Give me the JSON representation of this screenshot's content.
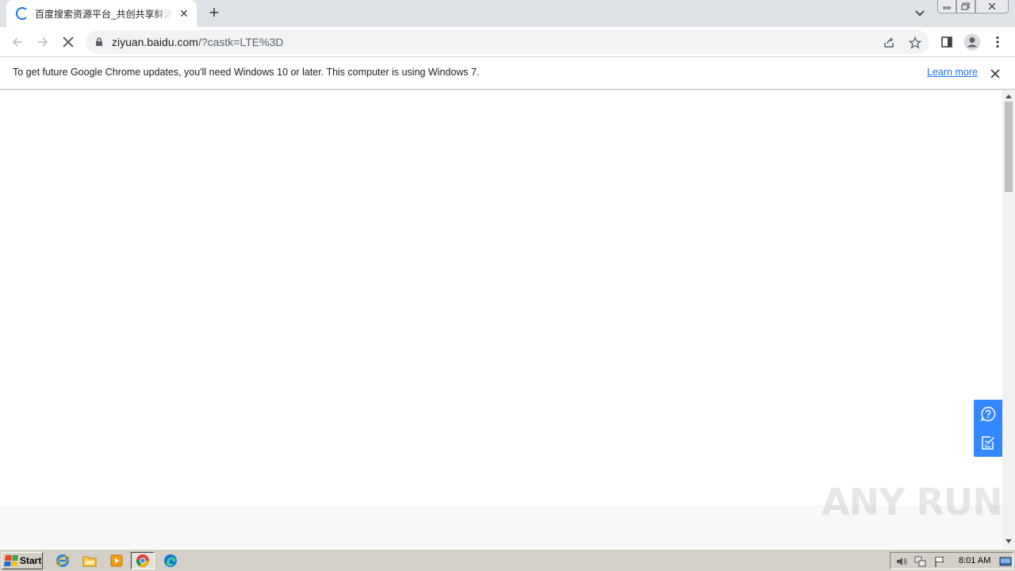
{
  "browser": {
    "tab": {
      "title": "百度搜索资源平台_共创共享鲜活搜索",
      "close_label": "✕"
    },
    "new_tab_label": "+",
    "address": {
      "host": "ziyuan.baidu.com",
      "path": "/?castk=LTE%3D"
    },
    "icons": [
      "back-icon",
      "forward-icon",
      "stop-icon",
      "lock-icon",
      "share-icon",
      "star-icon",
      "side-panel-icon",
      "profile-icon",
      "menu-icon"
    ]
  },
  "infobar": {
    "message": "To get future Google Chrome updates, you'll need Windows 10 or later. This computer is using Windows 7.",
    "link": "Learn more"
  },
  "page": {
    "side_buttons": [
      "help-icon",
      "feedback-icon"
    ],
    "accent_color": "#3388ff"
  },
  "watermark": {
    "text": "ANY RUN"
  },
  "taskbar": {
    "start_label": "Start",
    "apps": [
      "internet-explorer-icon",
      "file-explorer-icon",
      "media-player-icon",
      "chrome-icon",
      "edge-icon"
    ],
    "clock": "8:01 AM"
  }
}
